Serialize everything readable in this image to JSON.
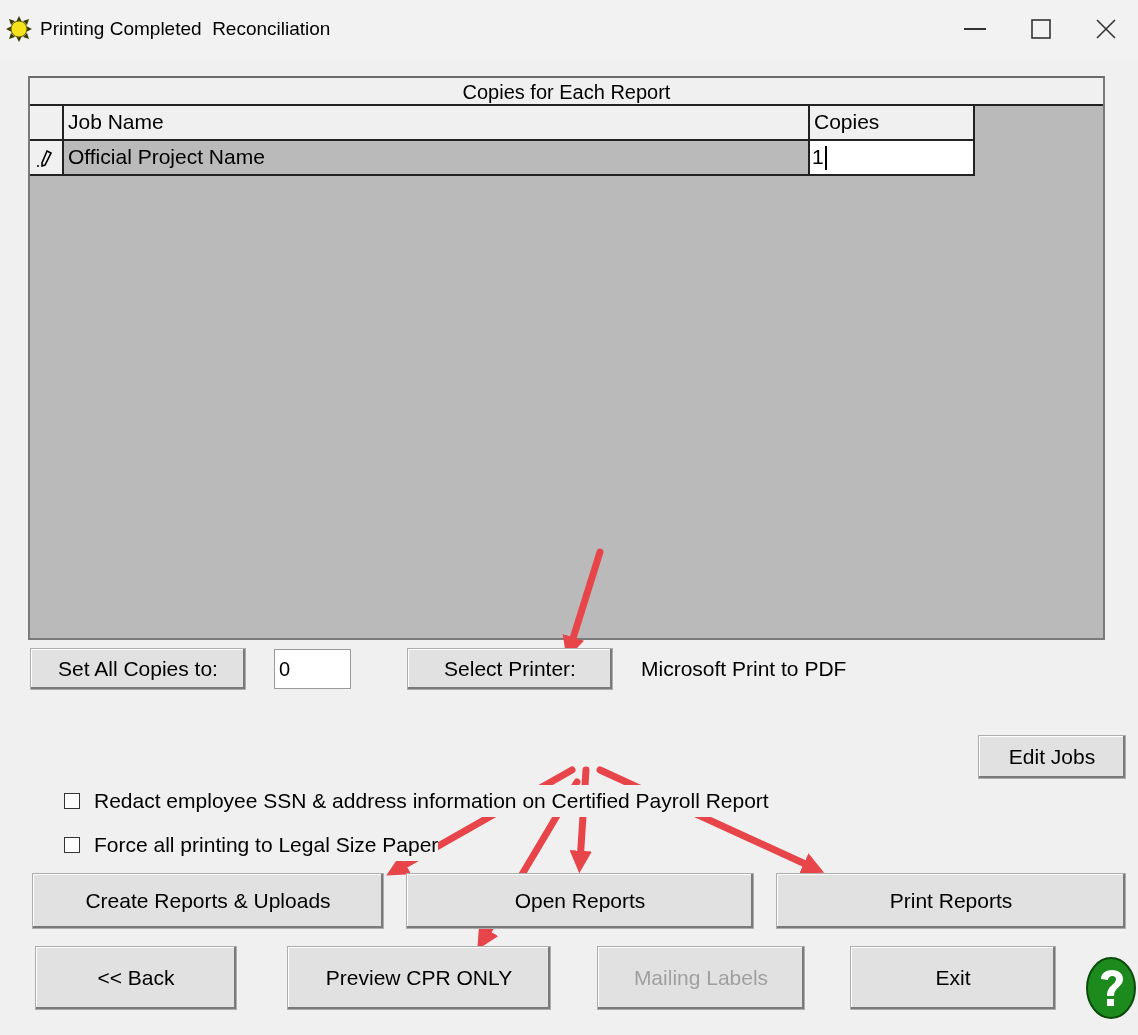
{
  "window": {
    "title": "Printing Completed  Reconciliation"
  },
  "grid": {
    "caption": "Copies for Each Report",
    "columns": [
      "Job Name",
      "Copies"
    ],
    "rows": [
      {
        "editing": true,
        "job_name": "Official Project Name",
        "copies": "1"
      }
    ]
  },
  "copies_setter": {
    "button": {
      "label": "Set All Copies to:"
    },
    "value": "0"
  },
  "printer": {
    "button": {
      "label": "Select Printer:"
    },
    "name": "Microsoft Print to PDF"
  },
  "edit_jobs": {
    "label": "Edit Jobs"
  },
  "options": [
    {
      "label": "Redact employee SSN & address information on Certified Payroll Report",
      "checked": false
    },
    {
      "label": "Force all printing to Legal Size Paper",
      "checked": false
    }
  ],
  "report_buttons": [
    {
      "label": "Create Reports & Uploads",
      "disabled": false
    },
    {
      "label": "Open Reports",
      "disabled": false
    },
    {
      "label": "Print Reports",
      "disabled": false
    }
  ],
  "nav_buttons": [
    {
      "label": "<< Back",
      "disabled": false
    },
    {
      "label": "Preview CPR ONLY",
      "disabled": false
    },
    {
      "label": "Mailing Labels",
      "disabled": true
    },
    {
      "label": "Exit",
      "disabled": false
    }
  ]
}
